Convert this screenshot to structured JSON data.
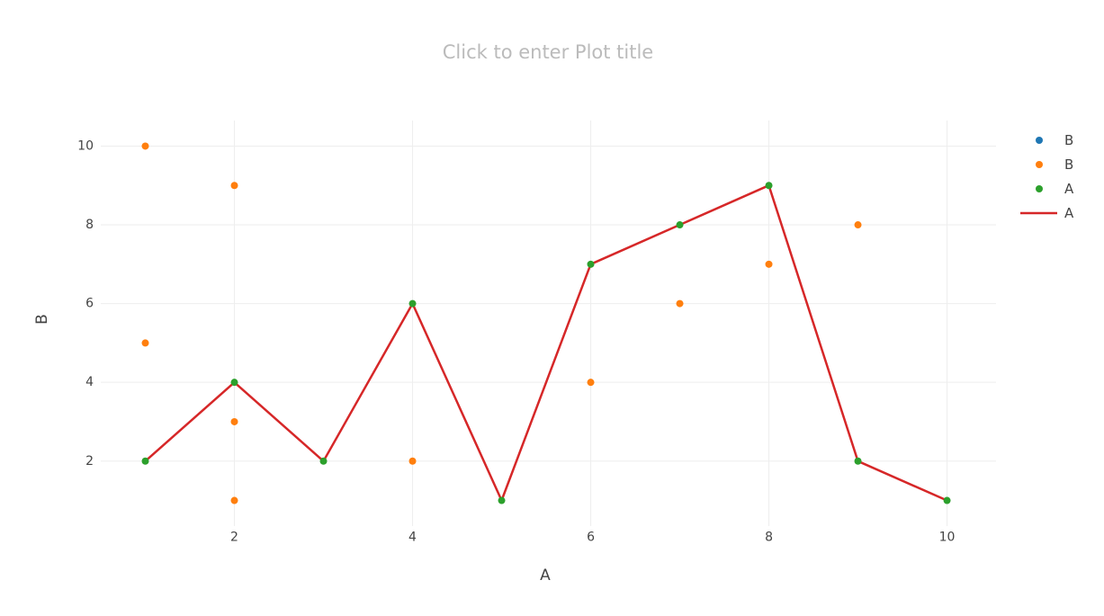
{
  "chart_data": {
    "type": "scatter",
    "title": "Click to enter Plot title",
    "xlabel": "A",
    "ylabel": "B",
    "xlim": [
      0.5,
      10.55
    ],
    "ylim": [
      0.35,
      10.65
    ],
    "x_ticks": [
      "2",
      "4",
      "6",
      "8",
      "10"
    ],
    "y_ticks": [
      "2",
      "4",
      "6",
      "8",
      "10"
    ],
    "grid": true,
    "legend_position": "top-right",
    "series": [
      {
        "name": "B",
        "mode": "markers",
        "color": "#1f77b4",
        "x": [],
        "y": []
      },
      {
        "name": "B",
        "mode": "markers",
        "color": "#ff7f0e",
        "x": [
          1,
          1,
          2,
          2,
          2,
          4,
          6,
          7,
          8,
          9
        ],
        "y": [
          10,
          5,
          9,
          3,
          1,
          2,
          4,
          6,
          7,
          8
        ]
      },
      {
        "name": "A",
        "mode": "markers",
        "color": "#2ca02c",
        "x": [
          1,
          2,
          3,
          4,
          5,
          6,
          7,
          8,
          9,
          10
        ],
        "y": [
          2,
          4,
          2,
          6,
          1,
          7,
          8,
          9,
          2,
          1
        ]
      },
      {
        "name": "A",
        "mode": "lines",
        "color": "#d62728",
        "x": [
          1,
          2,
          3,
          4,
          5,
          6,
          7,
          8,
          9,
          10
        ],
        "y": [
          2,
          4,
          2,
          6,
          1,
          7,
          8,
          9,
          2,
          1
        ]
      }
    ]
  }
}
